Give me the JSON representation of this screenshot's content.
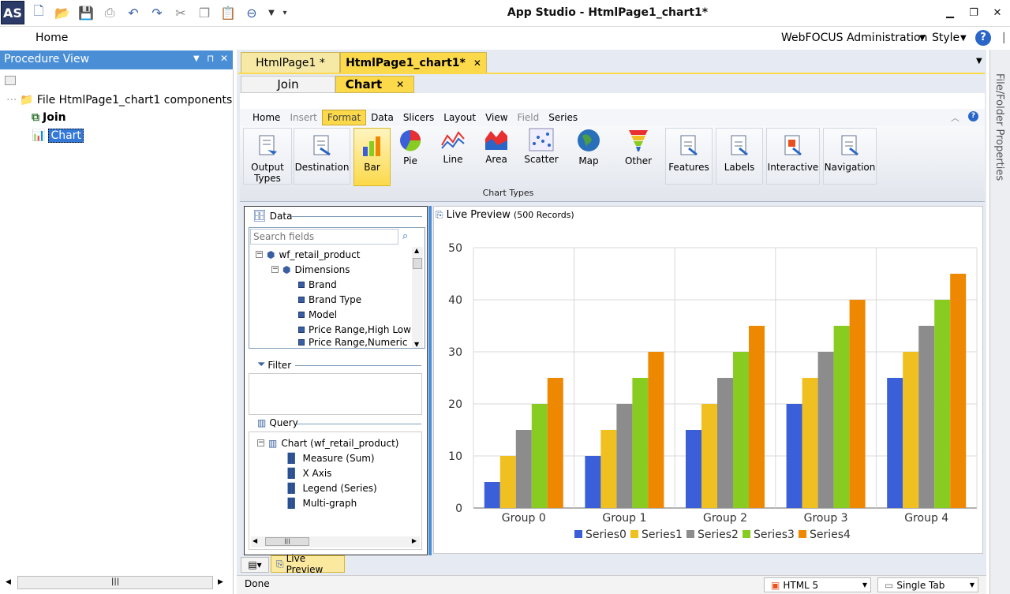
{
  "window": {
    "title": "App Studio - HtmlPage1_chart1*",
    "logo": "AS"
  },
  "menubar": {
    "home": "Home",
    "admin": "WebFOCUS Administration",
    "style": "Style"
  },
  "procedure_view": {
    "title": "Procedure View",
    "root": "File HtmlPage1_chart1 components",
    "items": [
      "Join",
      "Chart"
    ]
  },
  "doc_tabs": [
    "HtmlPage1 *",
    "HtmlPage1_chart1*"
  ],
  "sub_tabs": [
    "Join",
    "Chart"
  ],
  "ribbon_tabs": [
    "Home",
    "Insert",
    "Format",
    "Data",
    "Slicers",
    "Layout",
    "View",
    "Field",
    "Series"
  ],
  "ribbon_buttons": {
    "left": [
      {
        "label": "Output Types",
        "icon": "output-types-icon"
      },
      {
        "label": "Destination",
        "icon": "destination-icon"
      }
    ],
    "chart_types": [
      {
        "label": "Bar",
        "icon": "bar-chart-icon"
      },
      {
        "label": "Pie",
        "icon": "pie-chart-icon"
      },
      {
        "label": "Line",
        "icon": "line-chart-icon"
      },
      {
        "label": "Area",
        "icon": "area-chart-icon"
      },
      {
        "label": "Scatter",
        "icon": "scatter-chart-icon"
      },
      {
        "label": "Map",
        "icon": "globe-icon"
      },
      {
        "label": "Other",
        "icon": "funnel-icon"
      }
    ],
    "chart_types_group": "Chart Types",
    "right": [
      {
        "label": "Features",
        "icon": "features-icon"
      },
      {
        "label": "Labels",
        "icon": "labels-icon"
      },
      {
        "label": "Interactive",
        "icon": "interactive-icon"
      },
      {
        "label": "Navigation",
        "icon": "navigation-icon"
      }
    ]
  },
  "data_panel": {
    "title": "Data",
    "search_placeholder": "Search fields",
    "source": "wf_retail_product",
    "dimensions_label": "Dimensions",
    "fields": [
      "Brand",
      "Brand Type",
      "Model",
      "Price Range,High Low",
      "Price Range,Numeric"
    ]
  },
  "filter_panel": {
    "title": "Filter"
  },
  "query_panel": {
    "title": "Query",
    "root": "Chart (wf_retail_product)",
    "items": [
      "Measure (Sum)",
      "X Axis",
      "Legend (Series)",
      "Multi-graph"
    ]
  },
  "preview": {
    "title": "Live Preview",
    "records": "(500 Records)",
    "bottom_tab": "Live Preview"
  },
  "status": {
    "text": "Done",
    "format": "HTML 5",
    "tab_mode": "Single Tab"
  },
  "right_strip": {
    "label": "File/Folder Properties"
  },
  "chart_data": {
    "type": "bar",
    "categories": [
      "Group 0",
      "Group 1",
      "Group 2",
      "Group 3",
      "Group 4"
    ],
    "series": [
      {
        "name": "Series0",
        "values": [
          5,
          10,
          15,
          20,
          25
        ],
        "color": "#3a5fd9"
      },
      {
        "name": "Series1",
        "values": [
          10,
          15,
          20,
          25,
          30
        ],
        "color": "#f0c020"
      },
      {
        "name": "Series2",
        "values": [
          15,
          20,
          25,
          30,
          35
        ],
        "color": "#8c8c8c"
      },
      {
        "name": "Series3",
        "values": [
          20,
          25,
          30,
          35,
          40
        ],
        "color": "#88cc22"
      },
      {
        "name": "Series4",
        "values": [
          25,
          30,
          35,
          40,
          45
        ],
        "color": "#ee8800"
      }
    ],
    "ylim": [
      0,
      50
    ],
    "yticks": [
      0,
      10,
      20,
      30,
      40,
      50
    ],
    "grid": true,
    "legend": "bottom"
  }
}
